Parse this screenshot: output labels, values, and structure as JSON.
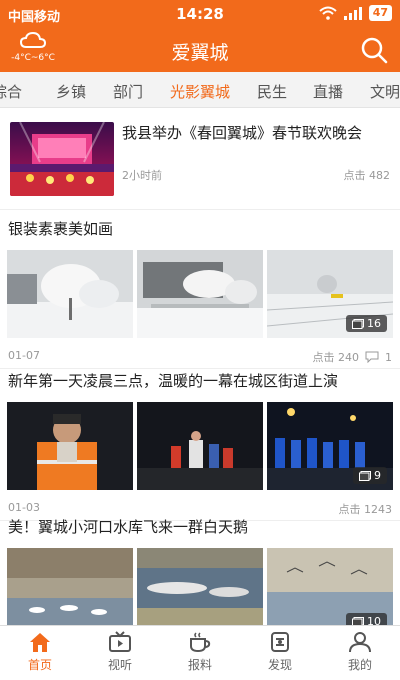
{
  "status_bar": {
    "carrier": "中国移动",
    "time": "14:28",
    "battery": "47",
    "icons": [
      "wifi-icon",
      "signal-icon",
      "battery-icon"
    ]
  },
  "app_bar": {
    "title": "爱翼城",
    "weather": {
      "icon": "cloud-icon",
      "temp": "-4°C~6°C"
    },
    "search_icon": "search-icon"
  },
  "tabs": [
    {
      "label": "综合"
    },
    {
      "label": "乡镇"
    },
    {
      "label": "部门"
    },
    {
      "label": "光影翼城",
      "active": true
    },
    {
      "label": "民生"
    },
    {
      "label": "直播"
    },
    {
      "label": "文明"
    }
  ],
  "feature": {
    "title": "我县举办《春回翼城》春节联欢晚会",
    "time": "2小时前",
    "views": "点击 482"
  },
  "articles": [
    {
      "headline": "银装素裹美如画",
      "date": "01-07",
      "views": "点击 240",
      "comments": "1",
      "photo_count": "16"
    },
    {
      "headline": "新年第一天凌晨三点，温暖的一幕在城区街道上演",
      "date": "01-03",
      "views": "点击 1243",
      "photo_count": "9"
    },
    {
      "headline": "美！翼城小河口水库飞来一群白天鹅",
      "photo_count": "10"
    }
  ],
  "bottom_nav": [
    {
      "label": "首页",
      "icon": "home-icon",
      "active": true
    },
    {
      "label": "视听",
      "icon": "tv-icon"
    },
    {
      "label": "报料",
      "icon": "coffee-icon"
    },
    {
      "label": "发现",
      "icon": "discover-icon"
    },
    {
      "label": "我的",
      "icon": "user-icon"
    }
  ],
  "colors": {
    "brand": "#f26a1b",
    "text": "#222222",
    "meta": "#999999"
  }
}
